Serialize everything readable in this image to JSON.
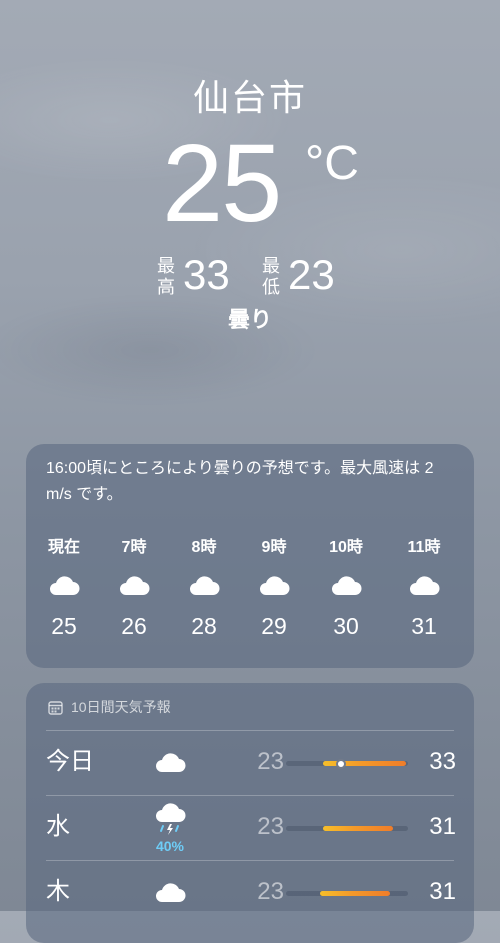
{
  "header": {
    "city": "仙台市",
    "temperature": "25",
    "unit": "°C",
    "high_label": "最高",
    "high": "33",
    "low_label": "最低",
    "low": "23",
    "condition": "曇り"
  },
  "hourly": {
    "summary": "16:00頃にところにより曇りの予想です。最大風速は 2 m/s です。",
    "items": [
      {
        "label": "現在",
        "icon": "cloud-icon",
        "temp": "25"
      },
      {
        "label": "7時",
        "icon": "cloud-icon",
        "temp": "26"
      },
      {
        "label": "8時",
        "icon": "cloud-icon",
        "temp": "28"
      },
      {
        "label": "9時",
        "icon": "cloud-icon",
        "temp": "29"
      },
      {
        "label": "10時",
        "icon": "cloud-icon",
        "temp": "30"
      },
      {
        "label": "11時",
        "icon": "cloud-icon",
        "temp": "31"
      }
    ]
  },
  "daily": {
    "title": "10日間天気予報",
    "title_icon": "calendar-icon",
    "days": [
      {
        "day": "今日",
        "icon": "cloud-icon",
        "precip": "",
        "low": "23",
        "high": "33",
        "range_start": 0.3,
        "range_end": 0.98,
        "current_pos": 0.45,
        "show_current": true
      },
      {
        "day": "水",
        "icon": "thunderstorm-rain-icon",
        "precip": "40%",
        "low": "23",
        "high": "31",
        "range_start": 0.3,
        "range_end": 0.88,
        "current_pos": null,
        "show_current": false
      },
      {
        "day": "木",
        "icon": "cloud-icon",
        "precip": "",
        "low": "23",
        "high": "31",
        "range_start": 0.28,
        "range_end": 0.85,
        "current_pos": null,
        "show_current": false
      }
    ]
  },
  "colors": {
    "precip": "#6ecdf7",
    "bar_start": "#f7bf2a",
    "bar_end": "#ef7d2a"
  }
}
